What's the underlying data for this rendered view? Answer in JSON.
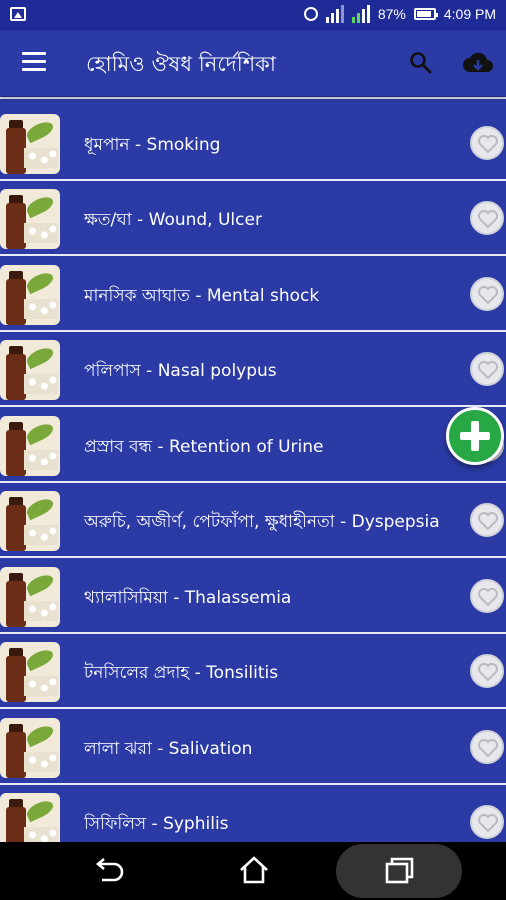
{
  "status_bar": {
    "battery": "87%",
    "time": "4:09 PM"
  },
  "app_bar": {
    "title": "হোমিও ঔষধ নির্দেশিকা",
    "icons": [
      "menu-icon",
      "search-icon",
      "cloud-download-icon"
    ]
  },
  "list": {
    "items": [
      {
        "label": "ধূমপান - Smoking"
      },
      {
        "label": "ক্ষত/ঘা - Wound, Ulcer"
      },
      {
        "label": "মানসিক আঘাত - Mental shock"
      },
      {
        "label": "পলিপাস - Nasal polypus"
      },
      {
        "label": "প্রস্রাব বন্ধ - Retention of Urine"
      },
      {
        "label": "অরুচি, অজীর্ণ, পেটফাঁপা, ক্ষুধাহীনতা - Dyspepsia"
      },
      {
        "label": "থ্যালাসিমিয়া - Thalassemia"
      },
      {
        "label": "টনসিলের প্রদাহ - Tonsilitis"
      },
      {
        "label": "লালা ঝরা - Salivation"
      },
      {
        "label": "সিফিলিস - Syphilis"
      }
    ]
  },
  "fab": {
    "icon": "plus-icon"
  },
  "nav_bar": {
    "icons": [
      "back-icon",
      "home-icon",
      "recent-apps-icon"
    ]
  },
  "colors": {
    "primary": "#2b3aa5",
    "status": "#1f2b96",
    "fab": "#27a845"
  }
}
